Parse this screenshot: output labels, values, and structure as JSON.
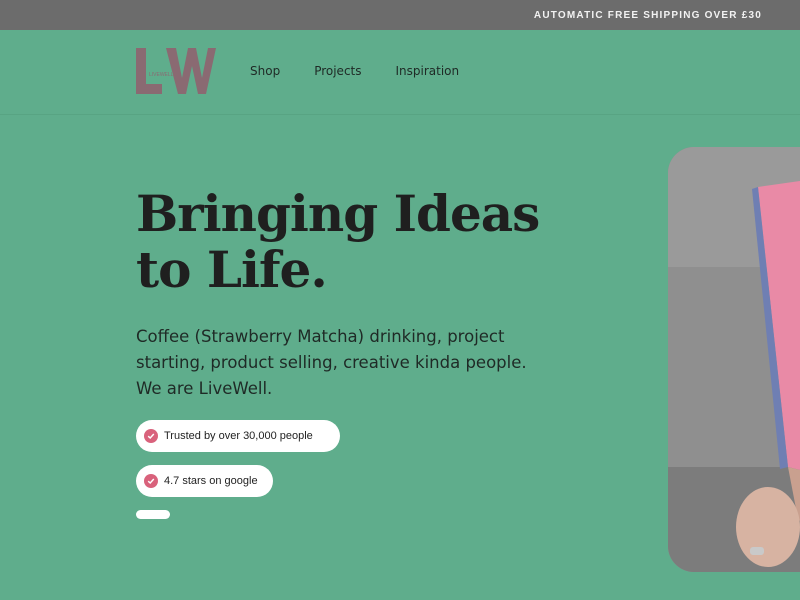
{
  "announcement": {
    "text": "AUTOMATIC FREE SHIPPING OVER £30"
  },
  "logo": {
    "letters": "LW",
    "sub": "LIVEWELL"
  },
  "nav": {
    "items": [
      "Shop",
      "Projects",
      "Inspiration"
    ]
  },
  "hero": {
    "headline_line1": "Bringing Ideas",
    "headline_line2": "to Life.",
    "description_line1": "Coffee (Strawberry Matcha) drinking, project",
    "description_line2": "starting, product selling, creative kinda people.",
    "description_line3": "We are LiveWell.",
    "badges": [
      "Trusted by over 30,000 people",
      "4.7 stars on google"
    ]
  },
  "colors": {
    "background": "#5fad8c",
    "topbar": "#6c6c6c",
    "accent_pink": "#d9627c",
    "logo": "#8a6a72"
  },
  "icons": {
    "badge_icon": "check-circle-icon",
    "image": "notebook-photo"
  }
}
